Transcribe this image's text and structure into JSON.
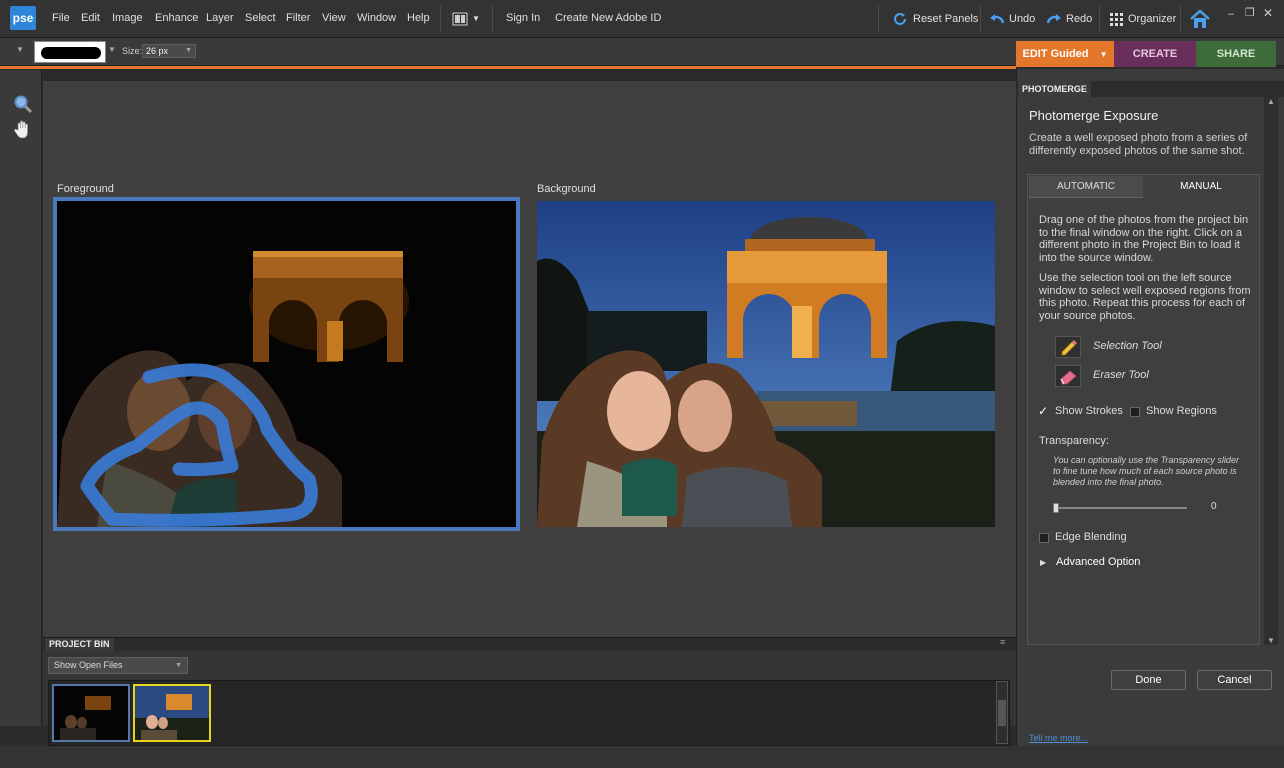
{
  "app": {
    "logo": "pse"
  },
  "menu": [
    "File",
    "Edit",
    "Image",
    "Enhance",
    "Layer",
    "Select",
    "Filter",
    "View",
    "Window",
    "Help"
  ],
  "header": {
    "sign_in": "Sign In",
    "create_id": "Create New Adobe ID",
    "reset_panels": "Reset Panels",
    "undo": "Undo",
    "redo": "Redo",
    "organizer": "Organizer"
  },
  "options": {
    "size_label": "Size:",
    "size_value": "26 px"
  },
  "modes": {
    "edit": "EDIT Guided",
    "create": "CREATE",
    "share": "SHARE"
  },
  "workspace": {
    "foreground_label": "Foreground",
    "background_label": "Background"
  },
  "bin": {
    "title": "PROJECT BIN",
    "select_value": "Show Open Files"
  },
  "panel": {
    "tab": "PHOTOMERGE",
    "title": "Photomerge Exposure",
    "description": "Create a well exposed photo from a series of differently exposed photos of the same shot.",
    "tabs": {
      "automatic": "AUTOMATIC",
      "manual": "MANUAL"
    },
    "instructions1": "Drag one of the photos from the project bin to the final window on the right. Click on a different photo in the Project Bin to load it into the source window.",
    "instructions2": "Use the selection tool on the left source window to select well exposed regions from this photo. Repeat this process for each of your source photos.",
    "selection_tool": "Selection Tool",
    "eraser_tool": "Eraser Tool",
    "show_strokes": "Show Strokes",
    "show_regions": "Show Regions",
    "transparency_label": "Transparency:",
    "transparency_hint": "You can optionally use the Transparency slider to fine tune how much of each source photo is blended into the final photo.",
    "transparency_value": "0",
    "edge_blending": "Edge Blending",
    "advanced": "Advanced Option",
    "done": "Done",
    "cancel": "Cancel",
    "tell_more": "Tell me more..."
  },
  "colors": {
    "accent_orange": "#e3782c",
    "create_purple": "#6a2e5a",
    "share_green": "#3e6b3a",
    "selection_blue": "#4a78bd",
    "stroke_blue": "#3a7ad4"
  }
}
